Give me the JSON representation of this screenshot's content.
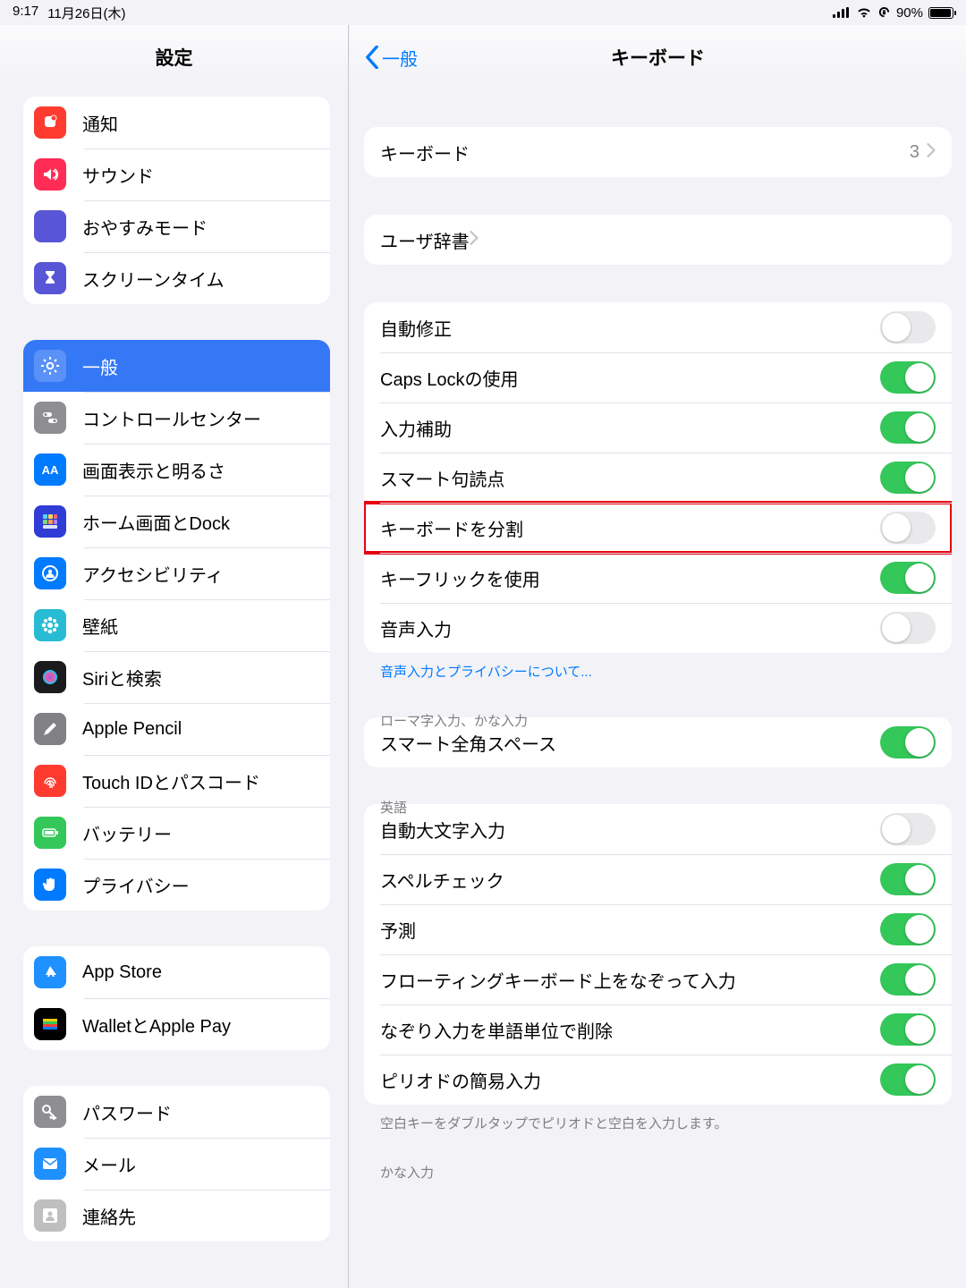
{
  "status": {
    "time": "9:17",
    "date": "11月26日(木)",
    "battery": "90%"
  },
  "sidebar": {
    "title": "設定",
    "groups": [
      {
        "items": [
          {
            "key": "notifications",
            "label": "通知",
            "bg": "#ff3b30",
            "icon": "bell"
          },
          {
            "key": "sounds",
            "label": "サウンド",
            "bg": "#ff2d55",
            "icon": "speaker"
          },
          {
            "key": "dnd",
            "label": "おやすみモード",
            "bg": "#5856d6",
            "icon": "moon"
          },
          {
            "key": "screentime",
            "label": "スクリーンタイム",
            "bg": "#5856d6",
            "icon": "hourglass"
          }
        ]
      },
      {
        "items": [
          {
            "key": "general",
            "label": "一般",
            "bg": "#8e8e93",
            "icon": "gear",
            "selected": true
          },
          {
            "key": "control-center",
            "label": "コントロールセンター",
            "bg": "#8e8e93",
            "icon": "switches"
          },
          {
            "key": "display",
            "label": "画面表示と明るさ",
            "bg": "#007aff",
            "icon": "aa"
          },
          {
            "key": "home",
            "label": "ホーム画面とDock",
            "bg": "#2f3cd6",
            "icon": "grid"
          },
          {
            "key": "accessibility",
            "label": "アクセシビリティ",
            "bg": "#007aff",
            "icon": "person"
          },
          {
            "key": "wallpaper",
            "label": "壁紙",
            "bg": "#28bcd4",
            "icon": "flower"
          },
          {
            "key": "siri",
            "label": "Siriと検索",
            "bg": "#1b1b1d",
            "icon": "siri"
          },
          {
            "key": "pencil",
            "label": "Apple Pencil",
            "bg": "#808085",
            "icon": "pencil"
          },
          {
            "key": "touchid",
            "label": "Touch IDとパスコード",
            "bg": "#ff3b30",
            "icon": "fingerprint"
          },
          {
            "key": "battery",
            "label": "バッテリー",
            "bg": "#34c759",
            "icon": "battery"
          },
          {
            "key": "privacy",
            "label": "プライバシー",
            "bg": "#007aff",
            "icon": "hand"
          }
        ]
      },
      {
        "items": [
          {
            "key": "appstore",
            "label": "App Store",
            "bg": "#1e90ff",
            "icon": "appstore"
          },
          {
            "key": "wallet",
            "label": "WalletとApple Pay",
            "bg": "#000",
            "icon": "wallet"
          }
        ]
      },
      {
        "items": [
          {
            "key": "passwords",
            "label": "パスワード",
            "bg": "#8e8e93",
            "icon": "key"
          },
          {
            "key": "mail",
            "label": "メール",
            "bg": "#1e90ff",
            "icon": "mail"
          },
          {
            "key": "contacts",
            "label": "連絡先",
            "bg": "#bfbfbf",
            "icon": "contacts"
          }
        ]
      }
    ]
  },
  "detail": {
    "back": "一般",
    "title": "キーボード",
    "sections": [
      {
        "rows": [
          {
            "type": "link",
            "label": "キーボード",
            "value": "3"
          }
        ]
      },
      {
        "rows": [
          {
            "type": "link",
            "label": "ユーザ辞書"
          }
        ]
      },
      {
        "footer_link": "音声入力とプライバシーについて...",
        "rows": [
          {
            "type": "toggle",
            "label": "自動修正",
            "on": false
          },
          {
            "type": "toggle",
            "label": "Caps Lockの使用",
            "on": true
          },
          {
            "type": "toggle",
            "label": "入力補助",
            "on": true
          },
          {
            "type": "toggle",
            "label": "スマート句読点",
            "on": true
          },
          {
            "type": "toggle",
            "label": "キーボードを分割",
            "on": false,
            "highlight": true
          },
          {
            "type": "toggle",
            "label": "キーフリックを使用",
            "on": true
          },
          {
            "type": "toggle",
            "label": "音声入力",
            "on": false
          }
        ]
      },
      {
        "header": "ローマ字入力、かな入力",
        "rows": [
          {
            "type": "toggle",
            "label": "スマート全角スペース",
            "on": true
          }
        ]
      },
      {
        "header": "英語",
        "footer": "空白キーをダブルタップでピリオドと空白を入力します。",
        "rows": [
          {
            "type": "toggle",
            "label": "自動大文字入力",
            "on": false
          },
          {
            "type": "toggle",
            "label": "スペルチェック",
            "on": true
          },
          {
            "type": "toggle",
            "label": "予測",
            "on": true
          },
          {
            "type": "toggle",
            "label": "フローティングキーボード上をなぞって入力",
            "on": true
          },
          {
            "type": "toggle",
            "label": "なぞり入力を単語単位で削除",
            "on": true
          },
          {
            "type": "toggle",
            "label": "ピリオドの簡易入力",
            "on": true
          }
        ]
      },
      {
        "header": "かな入力",
        "rows": []
      }
    ]
  }
}
